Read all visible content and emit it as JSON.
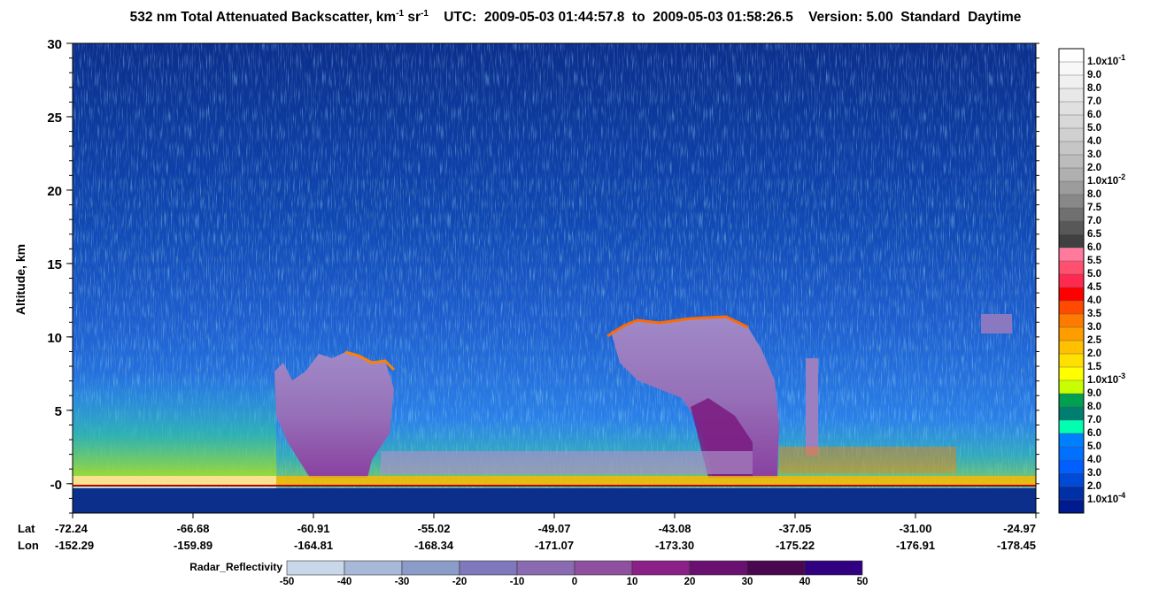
{
  "title_parts": {
    "main": "532 nm Total Attenuated Backscatter, km",
    "exp1": "-1",
    "sr": " sr",
    "exp2": "-1",
    "utc": "    UTC:  2009-05-03 01:44:57.8  to  2009-05-03 01:58:26.5    Version: 5.00  Standard  Daytime"
  },
  "chart_data": {
    "type": "heatmap",
    "title": "532 nm Total Attenuated Backscatter, km-1 sr-1",
    "subtitle": "UTC: 2009-05-03 01:44:57.8 to 2009-05-03 01:58:26.5 Version: 5.00 Standard Daytime",
    "ylabel": "Altitude, km",
    "ylim": [
      -2,
      30
    ],
    "y_ticks": [
      "-0",
      "5",
      "10",
      "15",
      "20",
      "25",
      "30"
    ],
    "x_row_labels": [
      "Lat",
      "Lon"
    ],
    "lat_ticks": [
      "-72.24",
      "-66.68",
      "-60.91",
      "-55.02",
      "-49.07",
      "-43.08",
      "-37.05",
      "-31.00",
      "-24.97"
    ],
    "lon_ticks": [
      "-152.29",
      "-159.89",
      "-164.81",
      "-168.34",
      "-171.07",
      "-173.30",
      "-175.22",
      "-176.91",
      "-178.45"
    ],
    "backscatter_colorbar": {
      "labels": [
        "1.0x10-1",
        "9.0",
        "8.0",
        "7.0",
        "6.0",
        "5.0",
        "4.0",
        "3.0",
        "2.0",
        "1.0x10-2",
        "8.0",
        "7.5",
        "7.0",
        "6.5",
        "6.0",
        "5.5",
        "5.0",
        "4.5",
        "4.0",
        "3.5",
        "3.0",
        "2.5",
        "2.0",
        "1.5",
        "1.0x10-3",
        "9.0",
        "8.0",
        "7.0",
        "6.0",
        "5.0",
        "4.0",
        "3.0",
        "2.0",
        "1.0x10-4"
      ],
      "colors": [
        "#ffffff",
        "#f8f8f8",
        "#f0f0f0",
        "#e8e8e8",
        "#e0e0e0",
        "#d8d8d8",
        "#d0d0d0",
        "#c6c6c6",
        "#bcbcbc",
        "#b0b0b0",
        "#9c9c9c",
        "#888888",
        "#707070",
        "#585858",
        "#404040",
        "#ff7a9c",
        "#ff5070",
        "#ff2a50",
        "#ff0000",
        "#ff4a00",
        "#ff7a00",
        "#ff9c00",
        "#ffc000",
        "#ffe000",
        "#ffff00",
        "#c8ff00",
        "#00a050",
        "#007f70",
        "#00ffb0",
        "#0080ff",
        "#0070ff",
        "#0060ff",
        "#004ad8",
        "#0030a8",
        "#001a90"
      ]
    },
    "radar_colorbar": {
      "name": "Radar_Reflectivity",
      "ticks": [
        "-50",
        "-40",
        "-30",
        "-20",
        "-10",
        "0",
        "10",
        "20",
        "30",
        "40",
        "50"
      ],
      "colors": [
        "#c8d8e8",
        "#a8b8d8",
        "#8c9cc8",
        "#8078bc",
        "#8a6ab0",
        "#9050a0",
        "#8a2088",
        "#6a1070",
        "#4a0850",
        "#300080"
      ]
    },
    "notes": "Lidar curtain: clear-air noise (blue) with higher noise/aerosol near surface; cloud features near -60.91/-55.02 lat at 4-9 km and near -43.08/-37.05 lat up to ~11 km overlaid with radar reflectivity (purple); surface return band near 0 km."
  }
}
